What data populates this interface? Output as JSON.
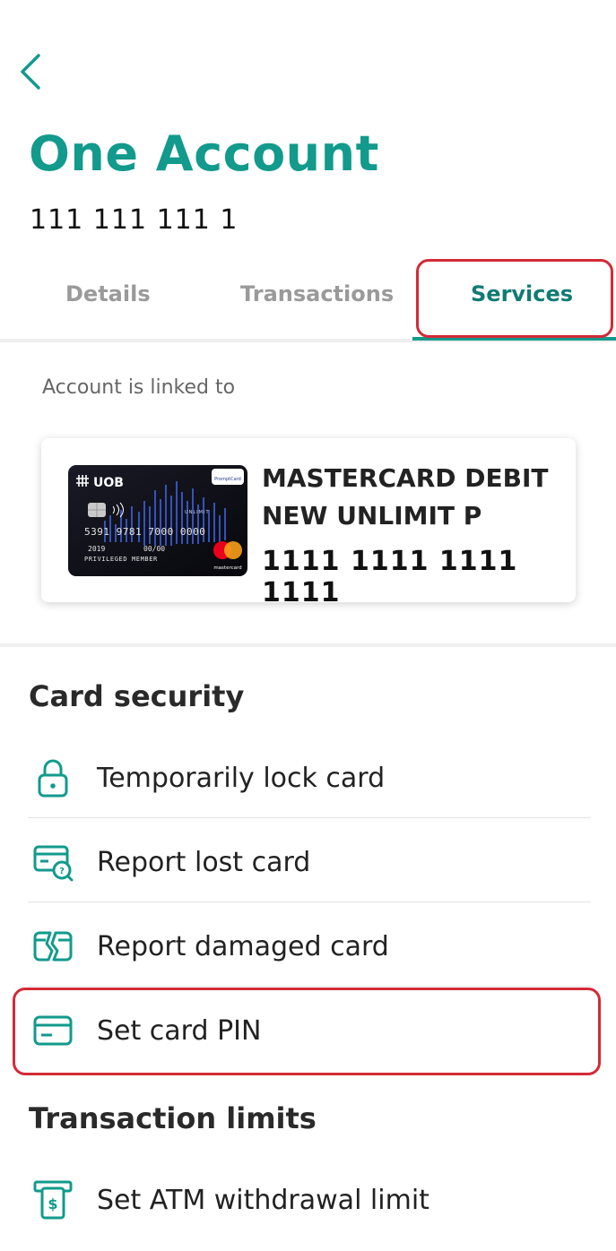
{
  "header": {
    "back_icon": "chevron-left-icon",
    "title": "One Account",
    "account_number": "111 111 111 1"
  },
  "tabs": [
    {
      "label": "Details",
      "active": false
    },
    {
      "label": "Transactions",
      "active": false
    },
    {
      "label": "Services",
      "active": true
    }
  ],
  "linked": {
    "label": "Account is linked to",
    "card": {
      "name_line1": "MASTERCARD DEBIT",
      "name_line2": "NEW UNLIMIT P",
      "number": "1111 1111 1111 1111",
      "image": {
        "brand": "UOB",
        "badge": "PromptCard",
        "product": "UNLIMIT",
        "pan": "5391 9781 7000 0000",
        "member_since": "2019",
        "valid_thru": "00/00",
        "tier": "PRIVILEGED MEMBER",
        "network": "mastercard"
      }
    }
  },
  "card_security": {
    "title": "Card security",
    "items": [
      {
        "label": "Temporarily lock card",
        "icon": "lock-icon"
      },
      {
        "label": "Report lost card",
        "icon": "card-search-icon"
      },
      {
        "label": "Report damaged card",
        "icon": "broken-card-icon"
      },
      {
        "label": "Set card PIN",
        "icon": "card-icon"
      }
    ]
  },
  "transaction_limits": {
    "title": "Transaction limits",
    "items": [
      {
        "label": "Set ATM withdrawal limit",
        "icon": "atm-cash-icon"
      }
    ]
  },
  "colors": {
    "brand_teal": "#129a8c",
    "active_tab": "#117b73",
    "highlight_red": "#d42a36"
  }
}
